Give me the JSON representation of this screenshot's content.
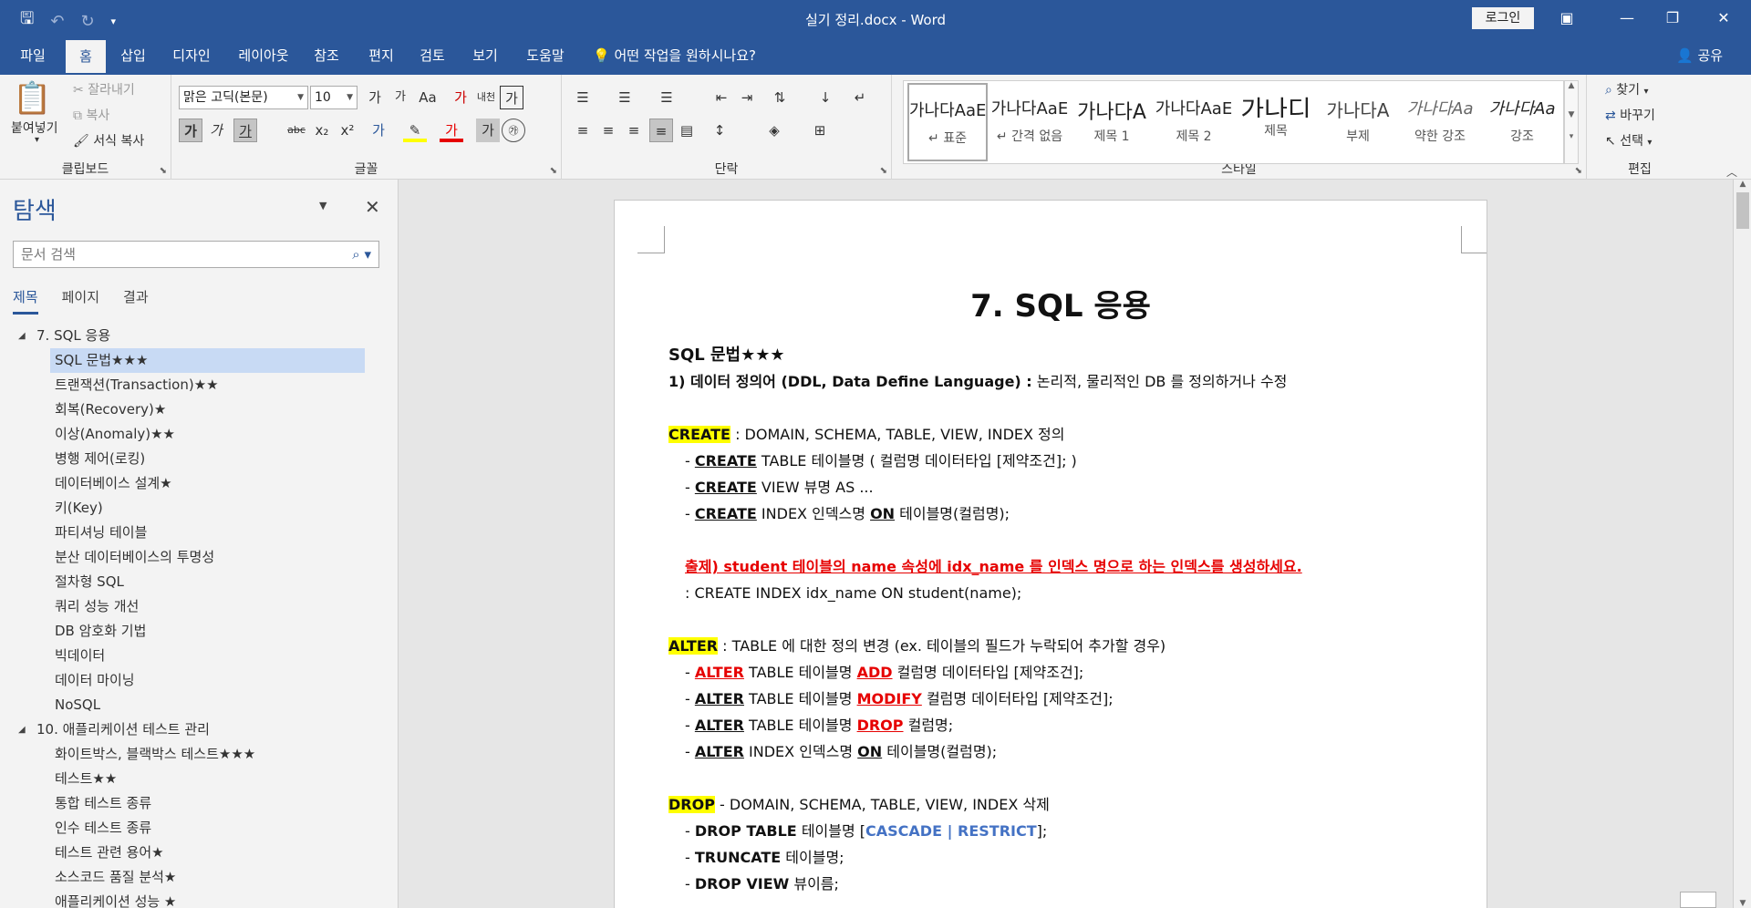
{
  "titlebar": {
    "window_title": "실기 정리.docx  -  Word",
    "login_label": "로그인",
    "qat_icons": [
      "save-icon",
      "undo-icon",
      "redo-icon",
      "customize-icon"
    ]
  },
  "menu": {
    "tabs": [
      "파일",
      "홈",
      "삽입",
      "디자인",
      "레이아웃",
      "참조",
      "편지",
      "검토",
      "보기",
      "도움말"
    ],
    "active_tab": "홈",
    "tell_me": "어떤 작업을 원하시나요?",
    "share": "공유"
  },
  "ribbon": {
    "clipboard": {
      "label": "클립보드",
      "paste": "붙여넣기",
      "cut": "잘라내기",
      "copy": "복사",
      "format_painter": "서식 복사"
    },
    "font": {
      "label": "글꼴",
      "font_name": "맑은 고딕(본문)",
      "font_size": "10"
    },
    "paragraph": {
      "label": "단락"
    },
    "styles": {
      "label": "스타일",
      "items": [
        {
          "sample": "가나다AaE",
          "name": "↵ 표준"
        },
        {
          "sample": "가나다AaE",
          "name": "↵ 간격 없음"
        },
        {
          "sample": "가나다A",
          "name": "제목 1"
        },
        {
          "sample": "가나다AaE",
          "name": "제목 2"
        },
        {
          "sample": "가나디",
          "name": "제목"
        },
        {
          "sample": "가나다A",
          "name": "부제"
        },
        {
          "sample": "가나다Aa",
          "name": "약한 강조"
        },
        {
          "sample": "가나다Aa",
          "name": "강조"
        }
      ]
    },
    "editing": {
      "label": "편집",
      "find": "찾기",
      "replace": "바꾸기",
      "select": "선택"
    }
  },
  "nav": {
    "title": "탐색",
    "search_placeholder": "문서 검색",
    "tabs": [
      "제목",
      "페이지",
      "결과"
    ],
    "items": [
      {
        "text": "7. SQL 응용",
        "level": 1
      },
      {
        "text": "SQL 문법★★★",
        "level": 2
      },
      {
        "text": "트랜잭션(Transaction)★★",
        "level": 2
      },
      {
        "text": "회복(Recovery)★",
        "level": 2
      },
      {
        "text": "이상(Anomaly)★★",
        "level": 2
      },
      {
        "text": "병행 제어(로킹)",
        "level": 2
      },
      {
        "text": "데이터베이스 설계★",
        "level": 2
      },
      {
        "text": "키(Key)",
        "level": 2
      },
      {
        "text": "파티셔닝 테이블",
        "level": 2
      },
      {
        "text": "분산 데이터베이스의 투명성",
        "level": 2
      },
      {
        "text": "절차형 SQL",
        "level": 2
      },
      {
        "text": "쿼리 성능 개선",
        "level": 2
      },
      {
        "text": "DB 암호화 기법",
        "level": 2
      },
      {
        "text": "빅데이터",
        "level": 2
      },
      {
        "text": "데이터 마이닝",
        "level": 2
      },
      {
        "text": "NoSQL",
        "level": 2
      },
      {
        "text": "10. 애플리케이션 테스트 관리",
        "level": 1
      },
      {
        "text": "화이트박스, 블랙박스 테스트★★★",
        "level": 2
      },
      {
        "text": "테스트★★",
        "level": 2
      },
      {
        "text": "통합 테스트 종류",
        "level": 2
      },
      {
        "text": "인수 테스트 종류",
        "level": 2
      },
      {
        "text": "테스트 관련 용어★",
        "level": 2
      },
      {
        "text": "소스코드 품질 분석★",
        "level": 2
      },
      {
        "text": "애플리케이션 성능 ★",
        "level": 2
      }
    ]
  },
  "doc": {
    "heading": "7. SQL 응용",
    "subheading": "SQL 문법★★★",
    "ddl_title": "1) 데이터 정의어 (DDL, Data Define Language) :",
    "ddl_desc": " 논리적, 물리적인 DB 를 정의하거나 수정",
    "create_kw": "CREATE",
    "create_desc": " : DOMAIN, SCHEMA, TABLE, VIEW, INDEX 정의",
    "create_lines": [
      [
        "- ",
        "CREATE",
        " TABLE 테이블명 ( 컬럼명 데이터타입 [제약조건]; )"
      ],
      [
        "- ",
        "CREATE",
        " VIEW 뷰명 AS ..."
      ],
      [
        "- ",
        "CREATE",
        " INDEX 인덱스명 ",
        "ON",
        " 테이블명(컬럼명);"
      ]
    ],
    "exam_q": "출제) student 테이블의 name 속성에 idx_name 를 인덱스 명으로 하는 인덱스를 생성하세요.",
    "exam_a": ": CREATE INDEX idx_name ON student(name);",
    "alter_kw": "ALTER",
    "alter_desc": " : TABLE 에 대한 정의 변경 (ex. 테이블의 필드가 누락되어 추가할 경우)",
    "alter_lines": [
      [
        "- ",
        "ALTER",
        " TABLE 테이블명 ",
        "ADD",
        " 컬럼명 데이터타입 [제약조건];"
      ],
      [
        "- ",
        "ALTER",
        " TABLE 테이블명 ",
        "MODIFY",
        " 컬럼명 데이터타입 [제약조건];"
      ],
      [
        "- ",
        "ALTER",
        " TABLE 테이블명 ",
        "DROP",
        " 컬럼명;"
      ],
      [
        "- ",
        "ALTER",
        " INDEX 인덱스명 ",
        "ON",
        " 테이블명(컬럼명);"
      ]
    ],
    "drop_kw": "DROP",
    "drop_desc": " - DOMAIN, SCHEMA, TABLE, VIEW, INDEX 삭제",
    "drop_lines": [
      [
        "- ",
        "DROP TABLE",
        " 테이블명 [",
        "CASCADE | RESTRICT",
        "];"
      ],
      [
        "- ",
        "TRUNCATE",
        " 테이블명;"
      ],
      [
        "- ",
        "DROP VIEW",
        " 뷰이름;"
      ]
    ]
  }
}
